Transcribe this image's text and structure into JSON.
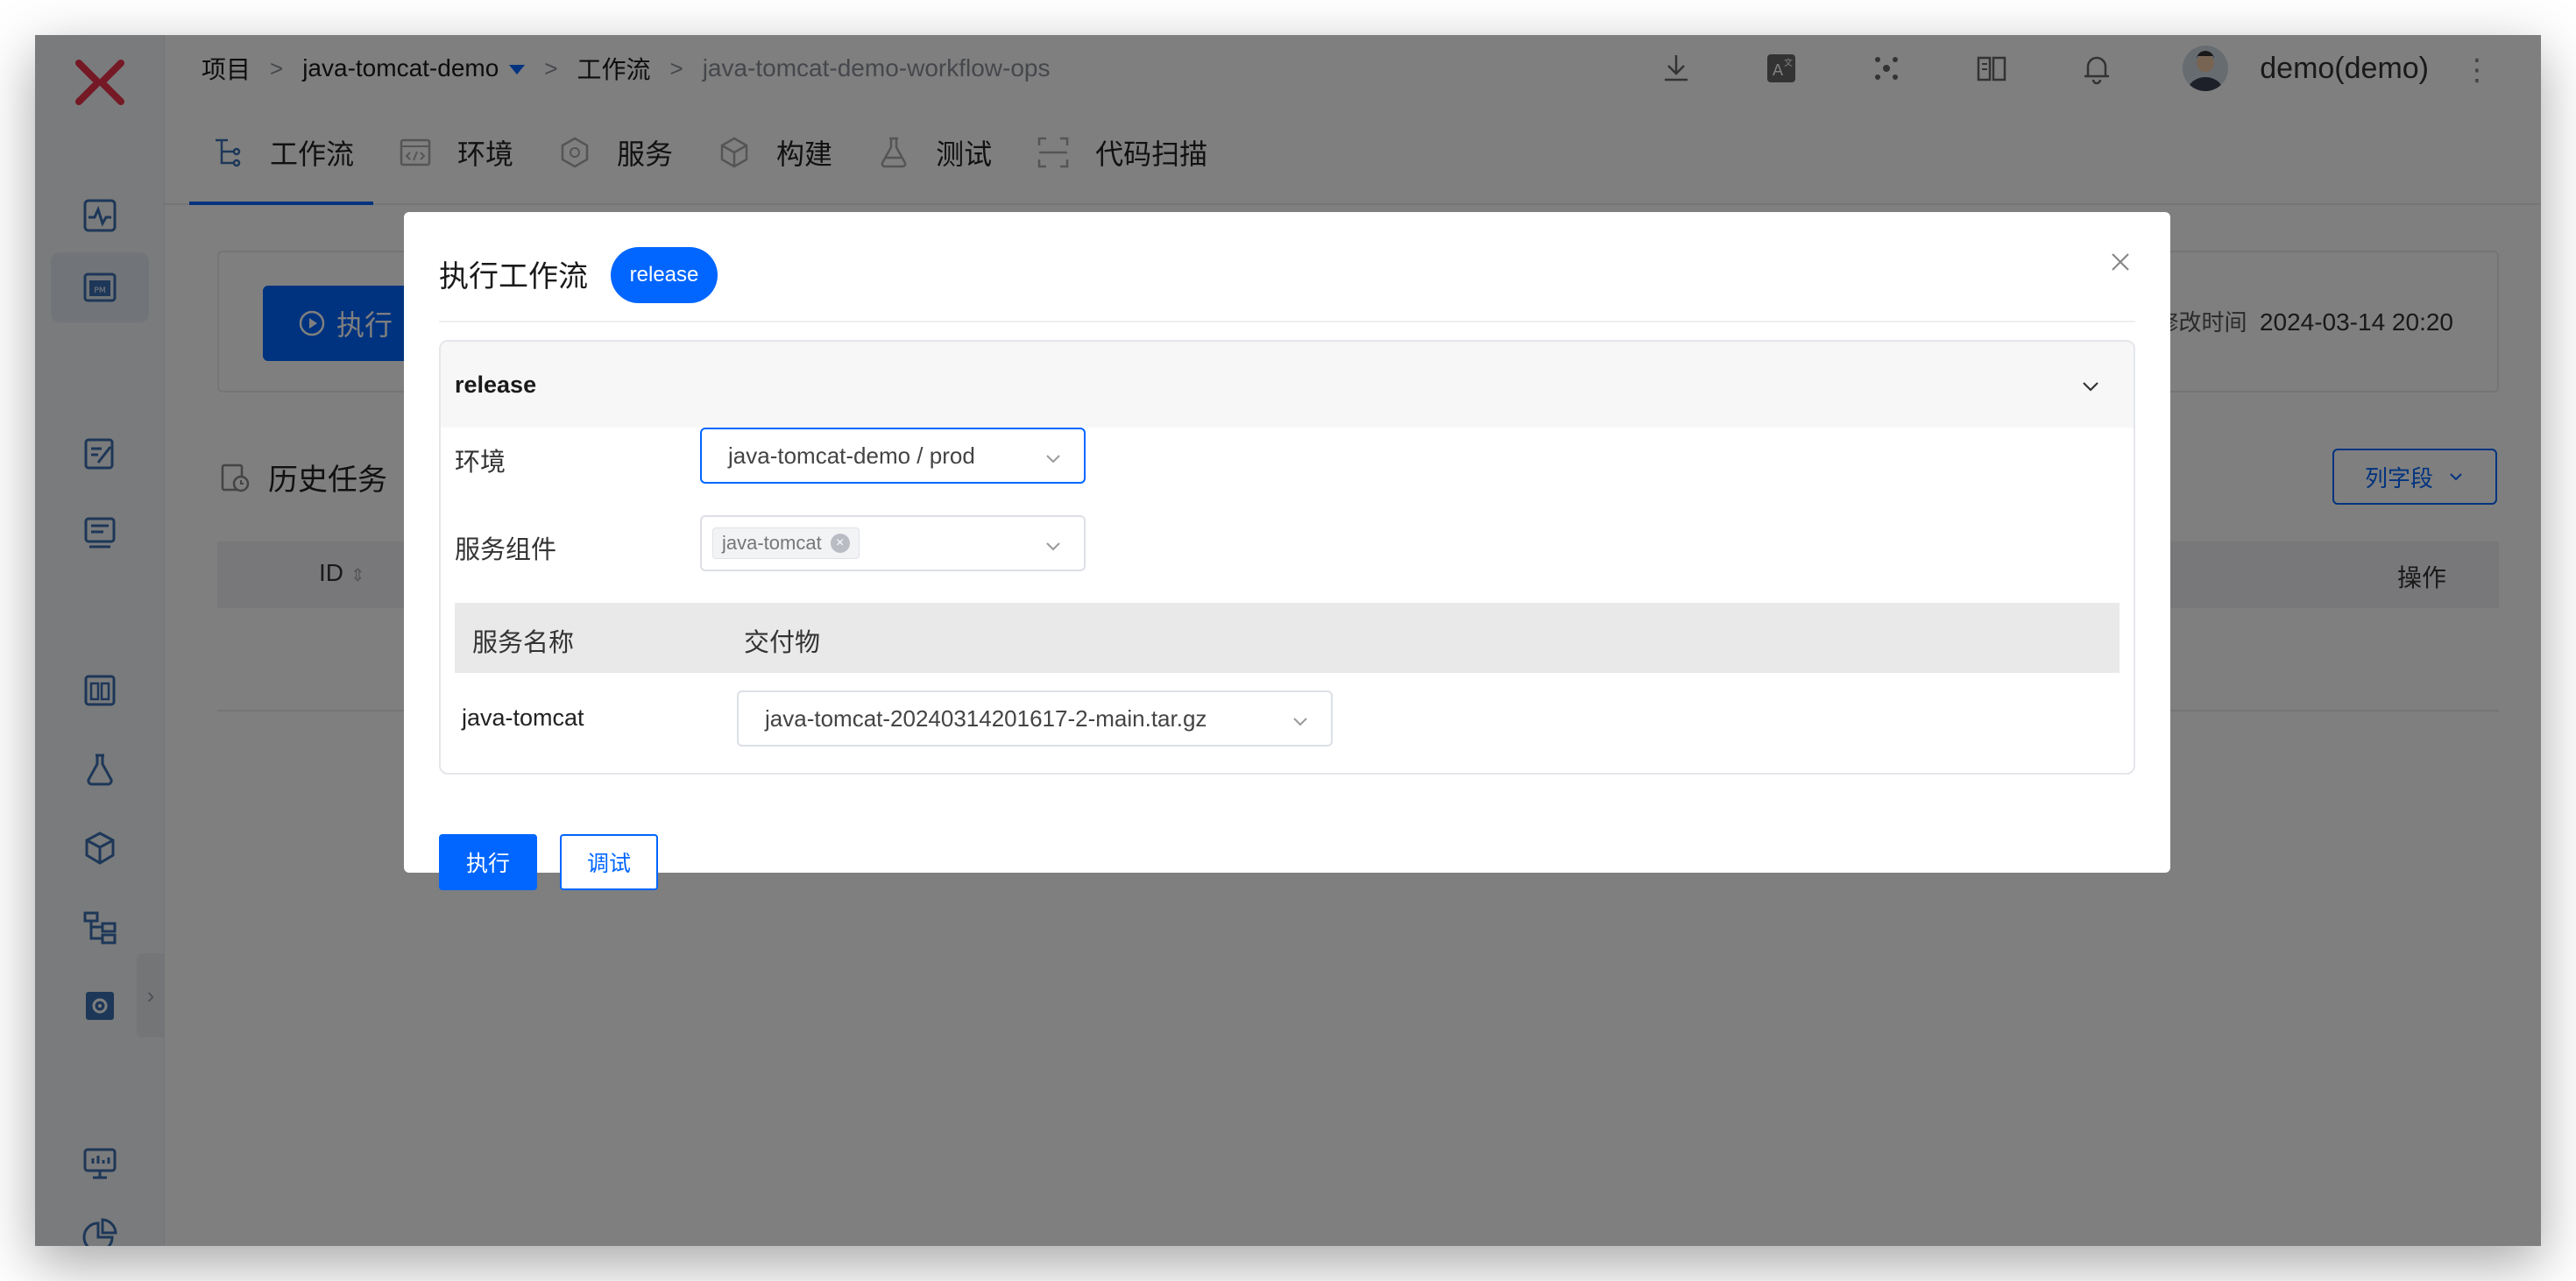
{
  "header": {
    "breadcrumb_root": "项目",
    "breadcrumb_project": "java-tomcat-demo",
    "breadcrumb_section": "工作流",
    "breadcrumb_workflow": "java-tomcat-demo-workflow-ops",
    "sep": ">",
    "user_name": "demo(demo)",
    "icons": [
      "download-icon",
      "translate-icon",
      "apps-icon",
      "book-icon",
      "bell-icon"
    ]
  },
  "tabs": [
    {
      "label": "工作流",
      "icon": "workflow-icon"
    },
    {
      "label": "环境",
      "icon": "code-window-icon"
    },
    {
      "label": "服务",
      "icon": "hexagon-icon"
    },
    {
      "label": "构建",
      "icon": "cube-icon"
    },
    {
      "label": "测试",
      "icon": "flask-icon"
    },
    {
      "label": "代码扫描",
      "icon": "scan-icon"
    }
  ],
  "background": {
    "run_button": "执行",
    "modified_label": "修改时间",
    "modified_value": "2024-03-14 20:20",
    "history_title": "历史任务",
    "column_fields": "列字段",
    "col_id": "ID",
    "col_operation": "操作"
  },
  "modal": {
    "title": "执行工作流",
    "badge": "release",
    "stage_name": "release",
    "env_label": "环境",
    "env_value": "java-tomcat-demo / prod",
    "service_label": "服务组件",
    "service_tag": "java-tomcat",
    "table_col_service": "服务名称",
    "table_col_artifact": "交付物",
    "row_service": "java-tomcat",
    "row_artifact": "java-tomcat-20240314201617-2-main.tar.gz",
    "execute_button": "执行",
    "debug_button": "调试"
  },
  "colors": {
    "accent": "#0066ff",
    "logo": "#e8334a"
  }
}
